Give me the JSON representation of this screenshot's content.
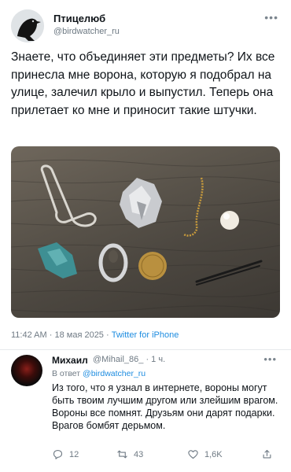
{
  "tweet": {
    "author_name": "Птицелюб",
    "author_handle": "@birdwatcher_ru",
    "text": "Знаете, что объединяет эти предметы? Их все принесла мне ворона, которую я подобрал на улице, залечил крыло и выпустил. Теперь она прилетает ко мне и приносит такие штучки.",
    "time": "11:42 AM",
    "date": "18 мая 2025",
    "source": "Twitter for iPhone",
    "separator": "·"
  },
  "reply": {
    "author_name": "Михаил",
    "author_handle": "@Mihail_86_",
    "age": "1 ч.",
    "reply_to_prefix": "В ответ",
    "reply_to_handle": "@birdwatcher_ru",
    "text": "Из того, что я узнал в интернете, вороны могут быть твоим лучшим другом или злейшим врагом. Вороны все помнят. Друзьям они дарят подарки. Врагов бомбят дерьмом.",
    "actions": {
      "replies": "12",
      "retweets": "43",
      "likes": "1,6K"
    }
  },
  "icons": {
    "more": "more-horizontal-icon",
    "reply": "speech-bubble-icon",
    "retweet": "retweet-icon",
    "like": "heart-icon",
    "share": "share-icon"
  },
  "colors": {
    "link": "#1d8ce0",
    "secondary_text": "#6f7a84"
  }
}
